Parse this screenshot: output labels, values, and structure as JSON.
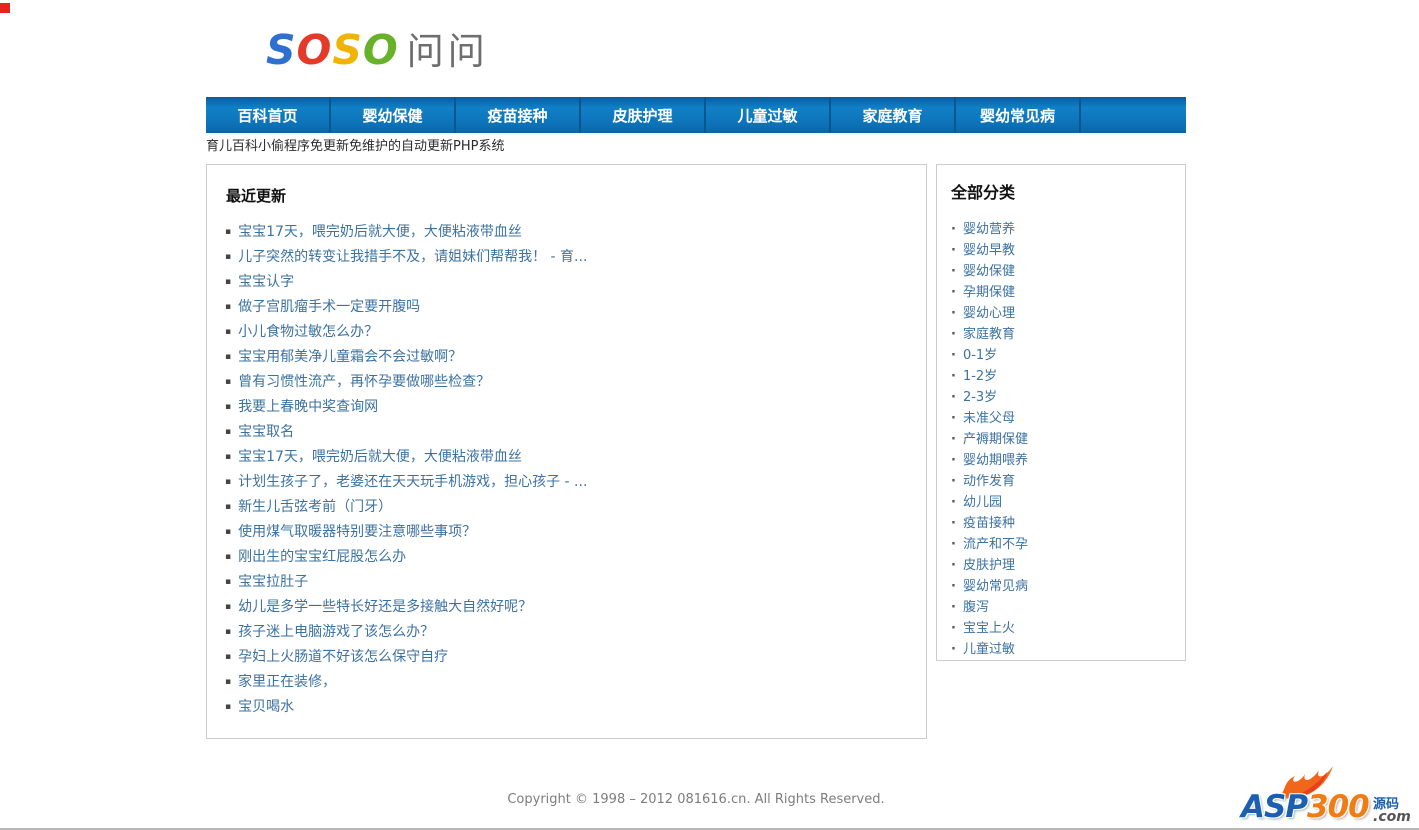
{
  "logo": {
    "s1": "S",
    "o1": "O",
    "s2": "S",
    "o2": "O",
    "suffix": "问问"
  },
  "nav": {
    "items": [
      "百科首页",
      "婴幼保健",
      "疫苗接种",
      "皮肤护理",
      "儿童过敏",
      "家庭教育",
      "婴幼常见病"
    ]
  },
  "tagline": "育儿百科小偷程序免更新免维护的自动更新PHP系统",
  "recent": {
    "title": "最近更新",
    "items": [
      "宝宝17天，喂完奶后就大便，大便粘液带血丝",
      "儿子突然的转变让我措手不及，请姐妹们帮帮我！ - 育...",
      "宝宝认字",
      "做子宫肌瘤手术一定要开腹吗",
      "小儿食物过敏怎么办？",
      "宝宝用郁美净儿童霜会不会过敏啊？",
      "曾有习惯性流产，再怀孕要做哪些检查？",
      "我要上春晚中奖查询网",
      "宝宝取名",
      "宝宝17天，喂完奶后就大便，大便粘液带血丝",
      "计划生孩子了，老婆还在天天玩手机游戏，担心孩子 - ...",
      "新生儿舌弦考前（门牙）",
      "使用煤气取暖器特别要注意哪些事项？",
      "刚出生的宝宝红屁股怎么办",
      "宝宝拉肚子",
      "幼儿是多学一些特长好还是多接触大自然好呢？",
      "孩子迷上电脑游戏了该怎么办？",
      "孕妇上火肠道不好该怎么保守自疗",
      "家里正在装修，",
      "宝贝喝水"
    ]
  },
  "categories": {
    "title": "全部分类",
    "items": [
      "婴幼营养",
      "婴幼早教",
      "婴幼保健",
      "孕期保健",
      "婴幼心理",
      "家庭教育",
      "0-1岁",
      "1-2岁",
      "2-3岁",
      "未准父母",
      "产褥期保健",
      "婴幼期喂养",
      "动作发育",
      "幼儿园",
      "疫苗接种",
      "流产和不孕",
      "皮肤护理",
      "婴幼常见病",
      "腹泻",
      "宝宝上火",
      "儿童过敏"
    ]
  },
  "footer": {
    "copyright": "Copyright © 1998 – 2012  081616.cn.  All Rights Reserved."
  },
  "watermark": {
    "asp": "ASP",
    "num": "300",
    "cn": "源码",
    "dotcom": ".com"
  },
  "colors": {
    "nav_blue": "#0e74ba",
    "nav_separator": "#07568f",
    "link_blue": "#3c72a2",
    "logo_s1": "#2f6fd0",
    "logo_o1": "#e43a2a",
    "logo_s2": "#f0b400",
    "logo_o2": "#68b22a",
    "logo_cn_gray": "#6e6e6e",
    "border_gray": "#cccccc",
    "footer_gray": "#7d7d7d",
    "watermark_blue": "#1c5fb2",
    "watermark_orange": "#f07c14",
    "red_marker": "#e8231e"
  }
}
